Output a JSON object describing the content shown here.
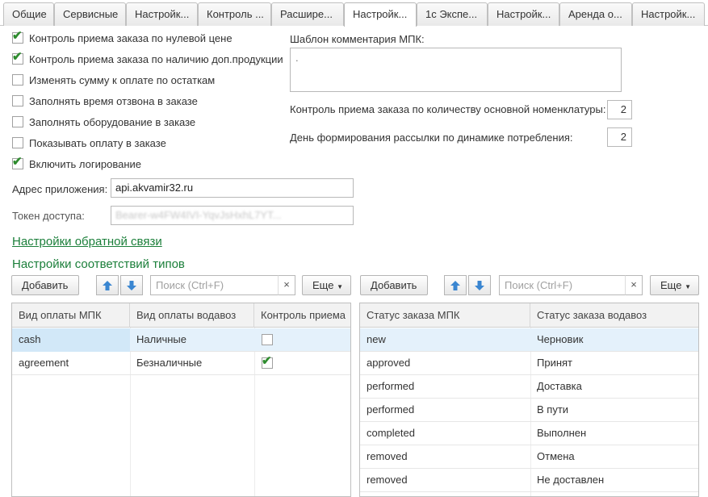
{
  "tabs": [
    {
      "label": "Общие"
    },
    {
      "label": "Сервисные"
    },
    {
      "label": "Настройк..."
    },
    {
      "label": "Контроль ..."
    },
    {
      "label": "Расшире..."
    },
    {
      "label": "Настройк..."
    },
    {
      "label": "1с Экспе..."
    },
    {
      "label": "Настройк..."
    },
    {
      "label": "Аренда о..."
    },
    {
      "label": "Настройк..."
    }
  ],
  "checkboxes": [
    {
      "label": "Контроль приема заказа по нулевой цене",
      "checked": true
    },
    {
      "label": "Контроль приема заказа по наличию доп.продукции",
      "checked": true
    },
    {
      "label": "Изменять сумму к оплате по остаткам",
      "checked": false
    },
    {
      "label": "Заполнять время отзвона в заказе",
      "checked": false
    },
    {
      "label": "Заполнять оборудование в заказе",
      "checked": false
    },
    {
      "label": "Показывать оплату в заказе",
      "checked": false
    },
    {
      "label": "Включить логирование",
      "checked": true
    }
  ],
  "app_address": {
    "label": "Адрес приложения:",
    "value": "api.akvamir32.ru"
  },
  "access_token": {
    "label": "Токен доступа:",
    "value": "Bearer-w4FW4IVI-YqvJsHxhL7YT..."
  },
  "mpk_comment": {
    "label": "Шаблон комментария МПК:",
    "value": "."
  },
  "nomenclature_control": {
    "label": "Контроль приема заказа по количеству основной номенклатуры:",
    "value": "2"
  },
  "mailing_day": {
    "label": "День формирования рассылки по динамике потребления:",
    "value": "2"
  },
  "feedback_link": "Настройки обратной связи",
  "type_mapping_title": "Настройки соответствий типов",
  "toolbar": {
    "add_label": "Добавить",
    "search_placeholder": "Поиск (Ctrl+F)",
    "clear_glyph": "×",
    "more_label": "Еще"
  },
  "payment_table": {
    "headers": [
      "Вид оплаты МПК",
      "Вид оплаты водавоз",
      "Контроль приема"
    ],
    "rows": [
      {
        "mpk": "cash",
        "vodavoz": "Наличные",
        "control": false
      },
      {
        "mpk": "agreement",
        "vodavoz": "Безналичные",
        "control": true
      }
    ]
  },
  "status_table": {
    "headers": [
      "Статус заказа МПК",
      "Статус заказа водавоз"
    ],
    "rows": [
      {
        "mpk": "new",
        "vodavoz": "Черновик"
      },
      {
        "mpk": "approved",
        "vodavoz": "Принят"
      },
      {
        "mpk": "performed",
        "vodavoz": "Доставка"
      },
      {
        "mpk": "performed",
        "vodavoz": "В пути"
      },
      {
        "mpk": "completed",
        "vodavoz": "Выполнен"
      },
      {
        "mpk": "removed",
        "vodavoz": "Отмена"
      },
      {
        "mpk": "removed",
        "vodavoz": "Не доставлен"
      }
    ]
  },
  "colors": {
    "accent_green": "#1b7f3a",
    "selection": "#e4f1fb",
    "check": "#2e8b2e",
    "arrow_blue": "#3a86d1"
  }
}
